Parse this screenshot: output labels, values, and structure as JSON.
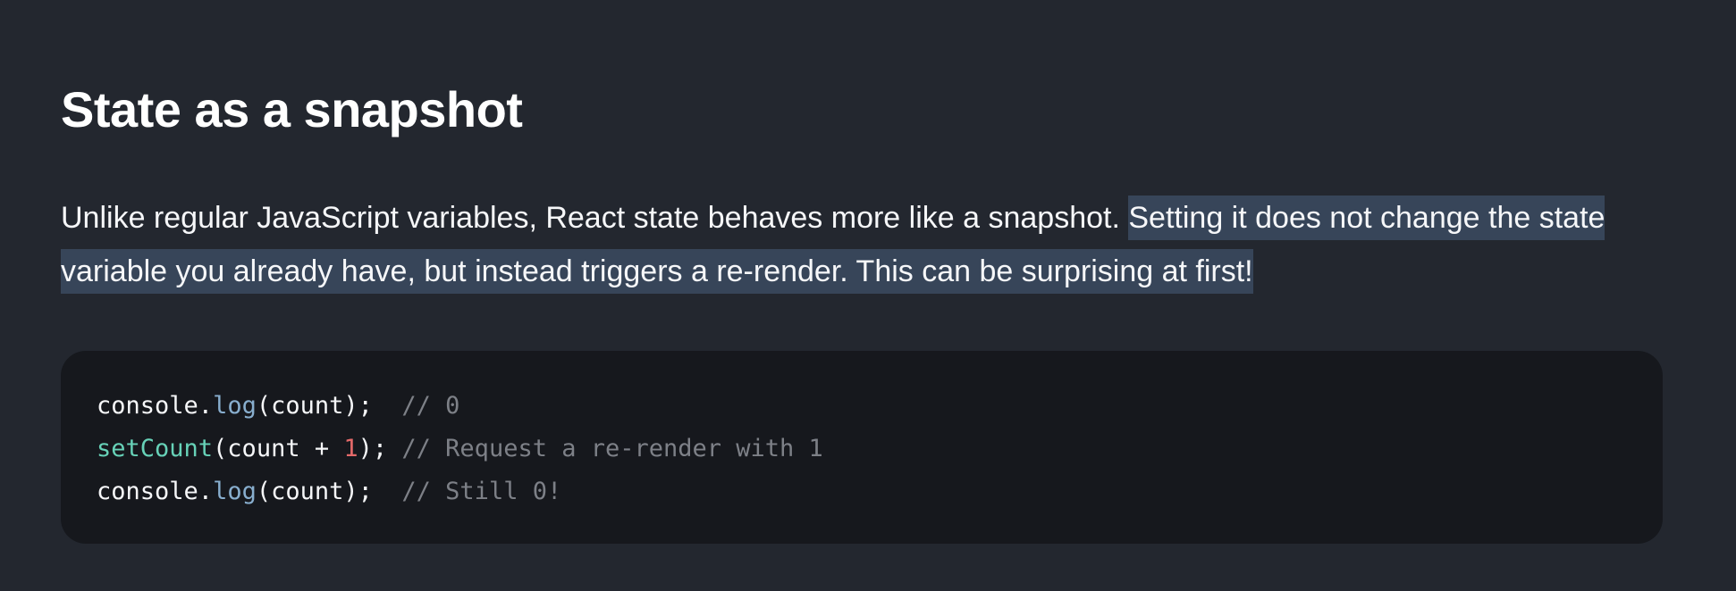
{
  "section": {
    "title": "State as a snapshot",
    "paragraph_plain": "Unlike regular JavaScript variables, React state behaves more like a snapshot. ",
    "paragraph_selected": "Setting it does not change the state variable you already have, but instead triggers a re-render. This can be surprising at first!"
  },
  "code": {
    "lines": [
      {
        "obj": "console",
        "dot": ".",
        "fn": "log",
        "args": "(count);",
        "gap": "  ",
        "comment": "// 0"
      },
      {
        "call": "setCount",
        "args_open": "(count + ",
        "num": "1",
        "args_close": ");",
        "gap": " ",
        "comment": "// Request a re-render with 1"
      },
      {
        "obj": "console",
        "dot": ".",
        "fn": "log",
        "args": "(count);",
        "gap": "  ",
        "comment": "// Still 0!"
      }
    ]
  },
  "colors": {
    "background": "#23272f",
    "code_background": "#16181d",
    "selection": "#374559",
    "function": "#88aece",
    "call": "#67d2b8",
    "number": "#e56a6a",
    "comment": "#7d8087"
  }
}
